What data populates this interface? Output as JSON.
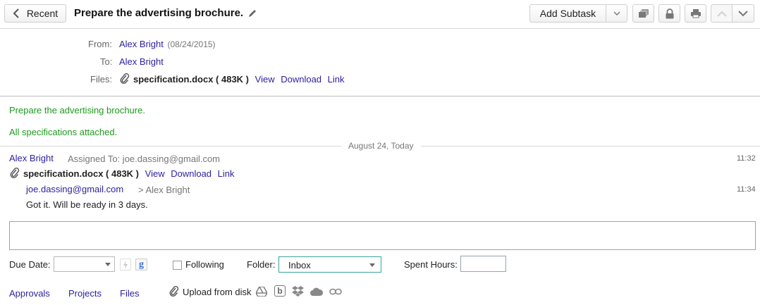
{
  "toolbar": {
    "back_label": "Recent",
    "title": "Prepare the advertising brochure.",
    "add_subtask_label": "Add Subtask"
  },
  "header": {
    "from_label": "From:",
    "from_name": "Alex Bright",
    "from_date": "(08/24/2015)",
    "to_label": "To:",
    "to_name": "Alex Bright",
    "files_label": "Files:",
    "file_name": "specification.docx",
    "file_size": "( 483K )",
    "view": "View",
    "download": "Download",
    "link": "Link"
  },
  "body": {
    "line1": "Prepare the advertising brochure.",
    "line2": "All specifications attached."
  },
  "timeline": {
    "date_divider": "August 24, Today",
    "entries": [
      {
        "author": "Alex Bright",
        "meta": "Assigned To: joe.dassing@gmail.com",
        "time": "11:32",
        "file_name": "specification.docx",
        "file_size": "( 483K )",
        "view": "View",
        "download": "Download",
        "link": "Link"
      },
      {
        "author": "joe.dassing@gmail.com",
        "meta": "> Alex Bright",
        "time": "11:34",
        "text": "Got it. Will be ready in 3 days."
      }
    ]
  },
  "form": {
    "reply_value": "",
    "due_date_label": "Due Date:",
    "due_date_value": "",
    "following_label": "Following",
    "following_checked": false,
    "folder_label": "Folder:",
    "folder_value": "Inbox",
    "spent_hours_label": "Spent Hours:",
    "spent_hours_value": "",
    "google_letter": "g"
  },
  "footer": {
    "approvals": "Approvals",
    "projects": "Projects",
    "files": "Files",
    "upload_label": "Upload from disk",
    "box_letter": "b"
  },
  "icons": {
    "paperclip": "paperclip-icon",
    "pencil": "pencil-icon",
    "copy": "copy-icon",
    "lock": "lock-icon",
    "print": "print-icon",
    "google": "google-icon"
  },
  "colors": {
    "link": "#2a1f9e",
    "green_text": "#1d9a1d",
    "folder_border": "#3aa39a"
  }
}
